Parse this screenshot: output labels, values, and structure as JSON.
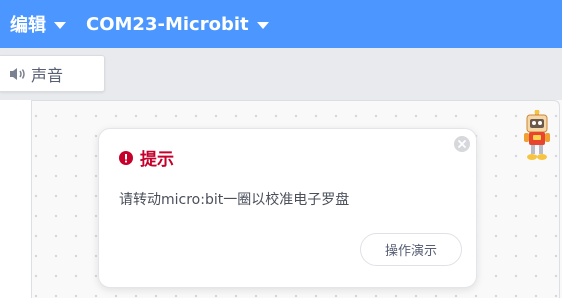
{
  "menubar": {
    "edit_label": "编辑",
    "device_label": "COM23-Microbit"
  },
  "toolbar": {
    "sound_tab_label": "声音",
    "sound_icon": "speaker-icon"
  },
  "dialog": {
    "title": "提示",
    "title_icon": "alert-circle-icon",
    "message": "请转动micro:bit一圈以校准电子罗盘",
    "demo_button_label": "操作演示",
    "close_icon": "close-icon"
  },
  "colors": {
    "menubar_bg": "#4c97ff",
    "title_red": "#c4002b",
    "workspace_bg": "#f9f9f9"
  }
}
